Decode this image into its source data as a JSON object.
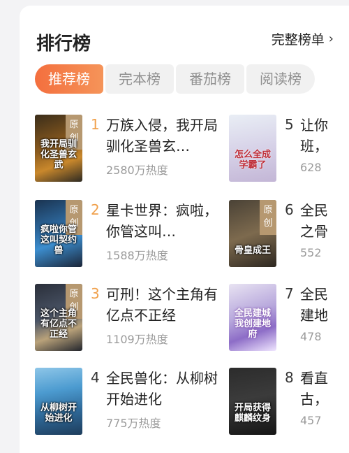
{
  "header": {
    "title": "排行榜",
    "more_label": "完整榜单",
    "more_icon": "chevron-right-icon"
  },
  "tabs": [
    {
      "label": "推荐榜",
      "active": true
    },
    {
      "label": "完本榜",
      "active": false
    },
    {
      "label": "番茄榜",
      "active": false
    },
    {
      "label": "阅读榜",
      "active": false
    }
  ],
  "badge_label": "原创",
  "books": [
    {
      "rank": "1",
      "title": "万族入侵，我开局驯化圣兽玄…",
      "heat": "2580万热度",
      "badge": true,
      "cover_text": "我开局驯化圣兽玄武"
    },
    {
      "rank": "2",
      "title": "星卡世界：疯啦，你管这叫…",
      "heat": "1588万热度",
      "badge": true,
      "cover_text": "疯啦你管这叫契约兽"
    },
    {
      "rank": "3",
      "title": "可刑！这个主角有亿点不正经",
      "heat": "1109万热度",
      "badge": true,
      "cover_text": "这个主角有亿点不正经"
    },
    {
      "rank": "4",
      "title": "全民兽化：从柳树开始进化",
      "heat": "775万热度",
      "badge": false,
      "cover_text": "从柳树开始进化"
    },
    {
      "rank": "5",
      "title": "让你班，",
      "heat": "628",
      "badge": false,
      "cover_text": "怎么全成学霸了"
    },
    {
      "rank": "6",
      "title": "全民之骨",
      "heat": "552",
      "badge": true,
      "cover_text": "骨皇成王"
    },
    {
      "rank": "7",
      "title": "全民建地",
      "heat": "478",
      "badge": false,
      "cover_text": "全民建城我创建地府"
    },
    {
      "rank": "8",
      "title": "看直古，",
      "heat": "457",
      "badge": false,
      "cover_text": "开局获得麒麟纹身"
    }
  ]
}
